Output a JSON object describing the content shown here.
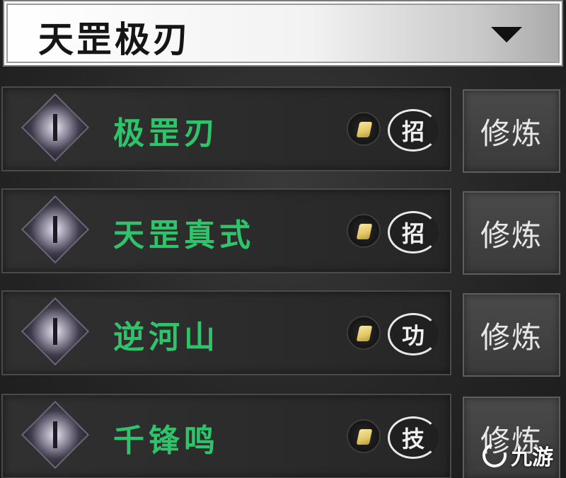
{
  "header": {
    "title": "天罡极刃"
  },
  "skills": [
    {
      "name": "极罡刃",
      "type": "招",
      "action": "修炼"
    },
    {
      "name": "天罡真式",
      "type": "招",
      "action": "修炼"
    },
    {
      "name": "逆河山",
      "type": "功",
      "action": "修炼"
    },
    {
      "name": "千锋鸣",
      "type": "技",
      "action": "修炼"
    }
  ],
  "watermark": {
    "text": "九游"
  },
  "colors": {
    "skill_name": "#2fc46a",
    "header_bg": "#f2f2f2",
    "panel_bg": "#2b2b2b"
  },
  "icons": {
    "dropdown": "triangle-down-icon",
    "currency": "gold-coin-icon"
  }
}
